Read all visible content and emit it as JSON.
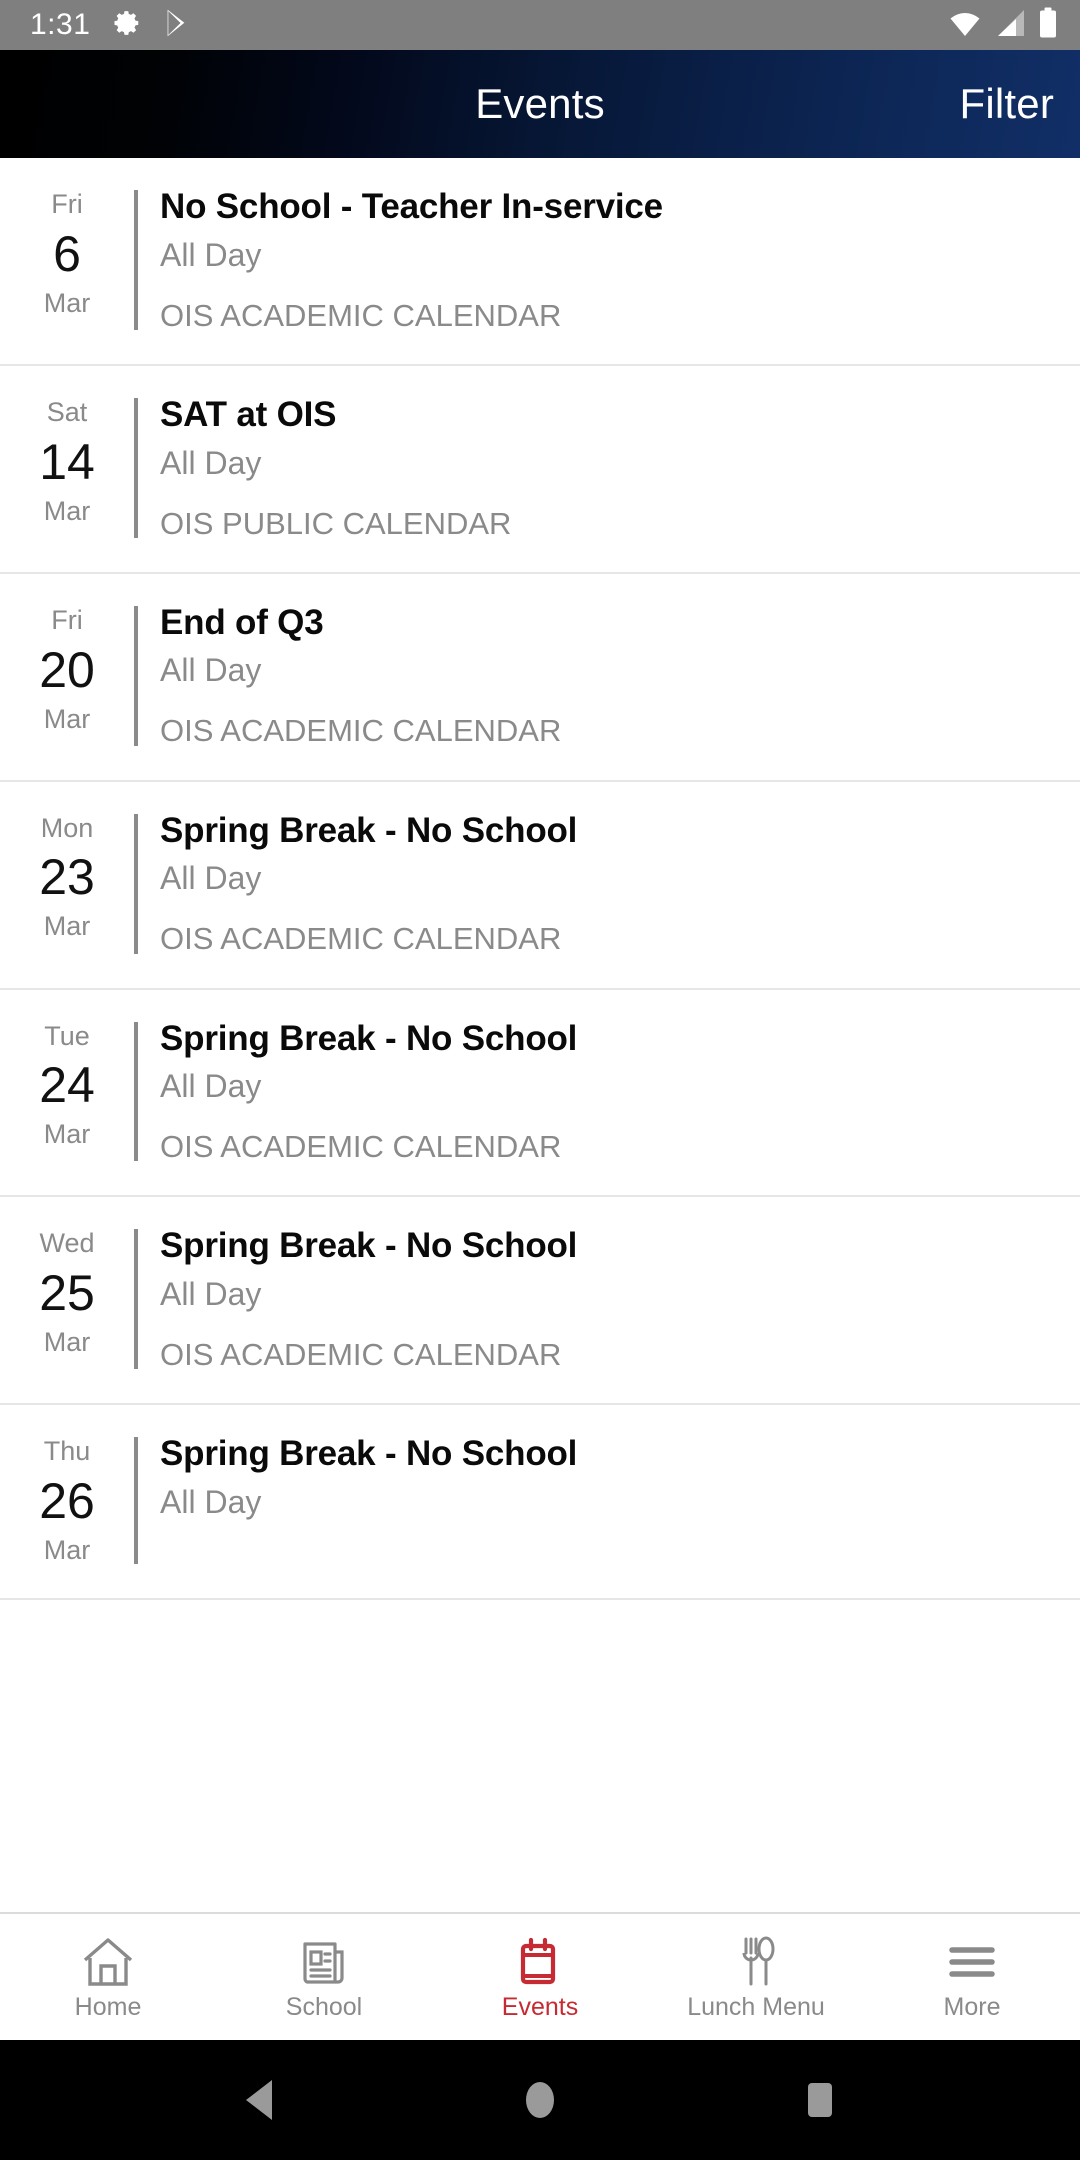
{
  "status_bar": {
    "time": "1:31",
    "left_icons": [
      "settings-gear-icon",
      "play-store-icon"
    ],
    "right_icons": [
      "wifi-icon",
      "cell-signal-icon",
      "battery-icon"
    ],
    "background_color": "#7f7f7f"
  },
  "header": {
    "title": "Events",
    "filter_label": "Filter",
    "gradient_start": "#000000",
    "gradient_end": "#112f67"
  },
  "events": [
    {
      "dow": "Fri",
      "day": "6",
      "month": "Mar",
      "title": "No School - Teacher In-service",
      "time": "All Day",
      "calendar": "OIS ACADEMIC CALENDAR"
    },
    {
      "dow": "Sat",
      "day": "14",
      "month": "Mar",
      "title": "SAT at OIS",
      "time": "All Day",
      "calendar": "OIS PUBLIC CALENDAR"
    },
    {
      "dow": "Fri",
      "day": "20",
      "month": "Mar",
      "title": "End of Q3",
      "time": "All Day",
      "calendar": "OIS ACADEMIC CALENDAR"
    },
    {
      "dow": "Mon",
      "day": "23",
      "month": "Mar",
      "title": "Spring Break - No School",
      "time": "All Day",
      "calendar": "OIS ACADEMIC CALENDAR"
    },
    {
      "dow": "Tue",
      "day": "24",
      "month": "Mar",
      "title": "Spring Break - No School",
      "time": "All Day",
      "calendar": "OIS ACADEMIC CALENDAR"
    },
    {
      "dow": "Wed",
      "day": "25",
      "month": "Mar",
      "title": "Spring Break - No School",
      "time": "All Day",
      "calendar": "OIS ACADEMIC CALENDAR"
    },
    {
      "dow": "Thu",
      "day": "26",
      "month": "Mar",
      "title": "Spring Break - No School",
      "time": "All Day",
      "calendar": ""
    }
  ],
  "tab_bar": {
    "active_color": "#c62a32",
    "inactive_color": "#8a8a8a",
    "items": [
      {
        "label": "Home",
        "icon": "home-icon",
        "active": false
      },
      {
        "label": "School",
        "icon": "newspaper-icon",
        "active": false
      },
      {
        "label": "Events",
        "icon": "calendar-icon",
        "active": true
      },
      {
        "label": "Lunch Menu",
        "icon": "fork-spoon-icon",
        "active": false
      },
      {
        "label": "More",
        "icon": "hamburger-menu-icon",
        "active": false
      }
    ]
  },
  "android_nav": {
    "back": "back-triangle-icon",
    "home": "home-circle-icon",
    "recents": "recents-square-icon"
  }
}
